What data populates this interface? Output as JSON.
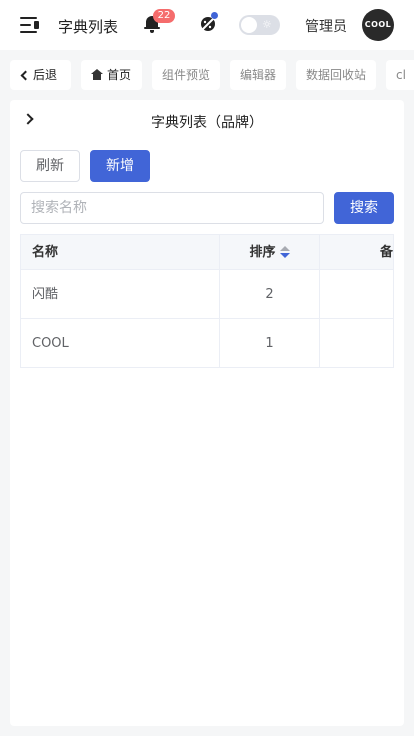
{
  "header": {
    "title": "字典列表",
    "notification_count": "22",
    "user_name": "管理员",
    "avatar_text": "COOL",
    "theme_toggle_icon": "☼"
  },
  "tabs": [
    {
      "label": "后退",
      "icon": "chevron-left-icon"
    },
    {
      "label": "首页",
      "icon": "home-icon"
    },
    {
      "label": "组件预览"
    },
    {
      "label": "编辑器"
    },
    {
      "label": "数据回收站"
    },
    {
      "label": "cl"
    }
  ],
  "panel": {
    "title": "字典列表（品牌）",
    "refresh_label": "刷新",
    "add_label": "新增",
    "search_placeholder": "搜索名称",
    "search_label": "搜索"
  },
  "table": {
    "columns": [
      "名称",
      "排序",
      "备"
    ],
    "rows": [
      {
        "name": "闪酷",
        "sort": "2"
      },
      {
        "name": "COOL",
        "sort": "1"
      }
    ]
  },
  "colors": {
    "primary": "#4165d7",
    "badge": "#f56c6c",
    "background": "#f5f6f7"
  }
}
